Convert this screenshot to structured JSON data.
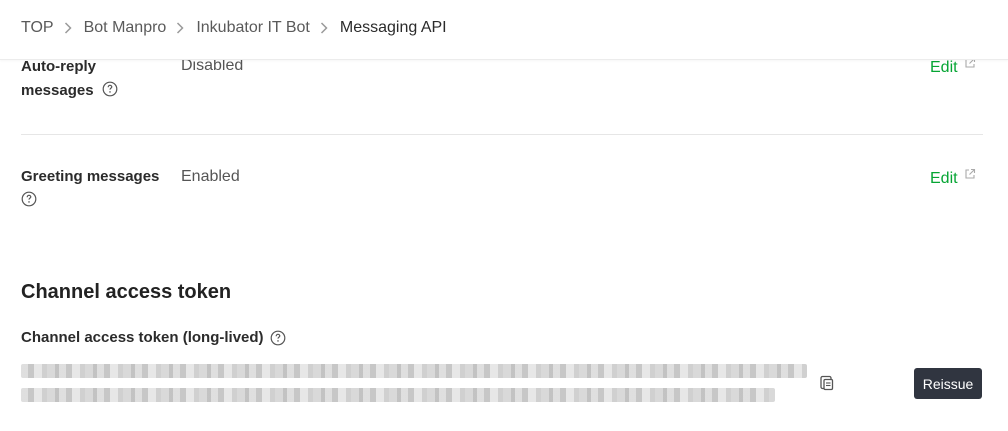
{
  "breadcrumb": {
    "items": [
      "TOP",
      "Bot Manpro",
      "Inkubator IT Bot",
      "Messaging API"
    ]
  },
  "settings": {
    "auto_reply": {
      "label_line1": "Auto-reply",
      "label_line2": "messages",
      "value": "Disabled",
      "edit_label": "Edit"
    },
    "greeting": {
      "label": "Greeting messages",
      "value": "Enabled",
      "edit_label": "Edit"
    }
  },
  "channel_access_token": {
    "section_title": "Channel access token",
    "field_label": "Channel access token (long-lived)",
    "reissue_label": "Reissue"
  },
  "colors": {
    "accent_green": "#06a534",
    "dark_button": "#303540"
  },
  "icons": {
    "breadcrumb_separator": "chevron-right-icon",
    "help": "help-circle-icon",
    "external_link": "external-link-icon",
    "copy": "copy-icon"
  }
}
